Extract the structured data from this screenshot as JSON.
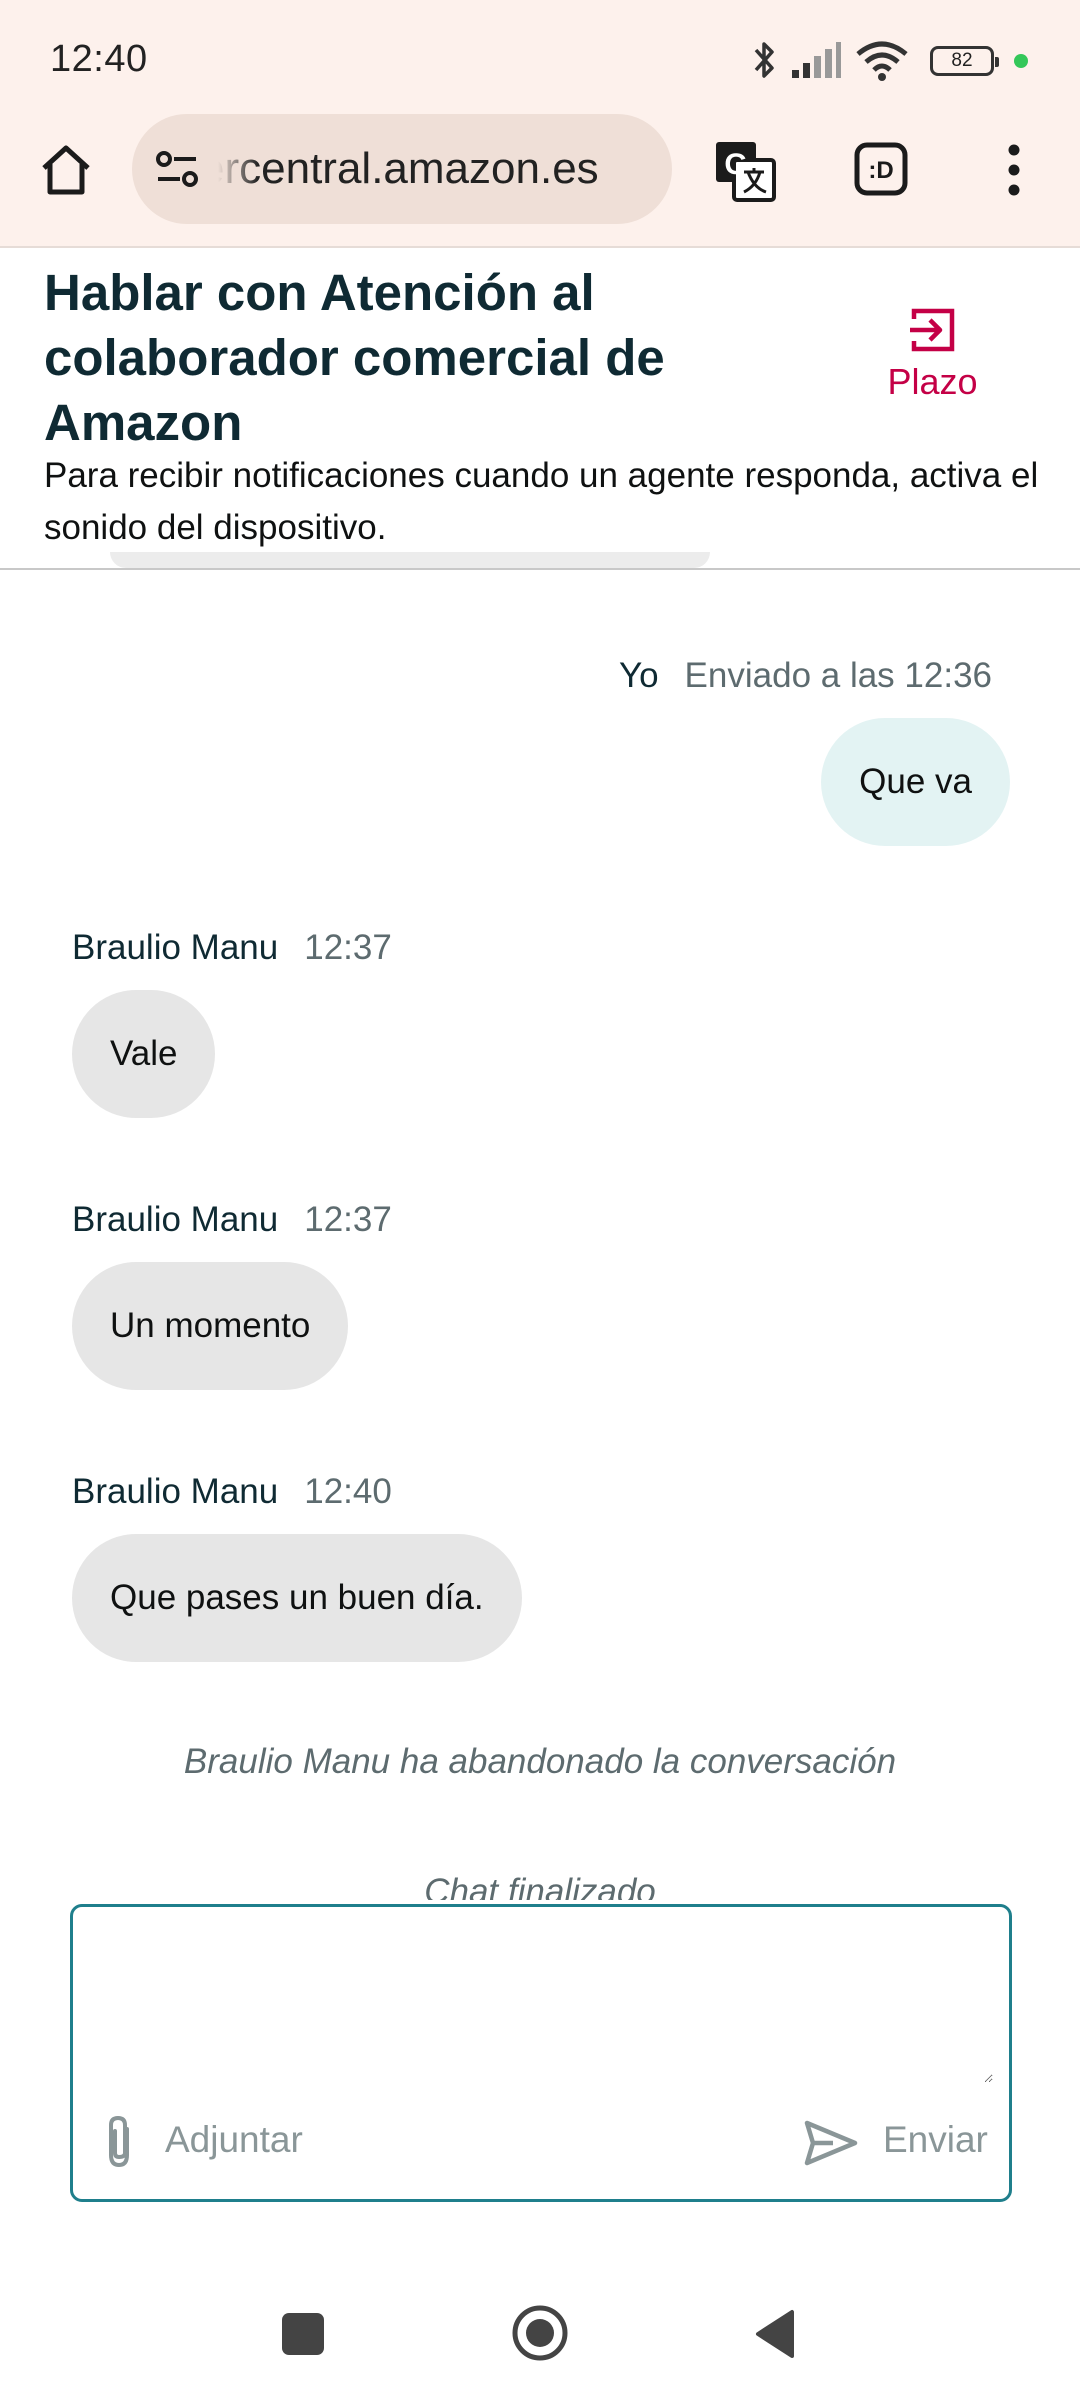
{
  "status_bar": {
    "time": "12:40",
    "battery": "82",
    "icons": [
      "bluetooth-icon",
      "signal-icon",
      "wifi-icon",
      "battery-icon"
    ]
  },
  "browser": {
    "url": "sellercentral.amazon.es",
    "toolbar_icons": [
      "home-icon",
      "site-settings-icon",
      "translate-icon",
      "extension-icon",
      "more-icon"
    ]
  },
  "header": {
    "title": "Hablar con Atención al colaborador comercial de Amazon",
    "subtitle": "Para recibir notificaciones cuando un agente responda, activa el sonido del dispositivo.",
    "end_label": "Plazo"
  },
  "messages": [
    {
      "sender": "Yo",
      "time": "Enviado a las 12:36",
      "text": "Que va",
      "direction": "out"
    },
    {
      "sender": "Braulio Manu",
      "time": "12:37",
      "text": "Vale",
      "direction": "in"
    },
    {
      "sender": "Braulio Manu",
      "time": "12:37",
      "text": "Un momento",
      "direction": "in"
    },
    {
      "sender": "Braulio Manu",
      "time": "12:40",
      "text": "Que pases un buen día.",
      "direction": "in"
    }
  ],
  "system_notes": {
    "left": "Braulio Manu ha abandonado la conversación",
    "ended": "Chat finalizado"
  },
  "composer": {
    "value": "",
    "attach_label": "Adjuntar",
    "send_label": "Enviar"
  },
  "colors": {
    "browser_bar": "#fdf1ec",
    "accent_end": "#c40046",
    "composer_border": "#1f7f8c",
    "bubble_in": "#e6e6e6",
    "bubble_out": "#e3f3f3"
  }
}
